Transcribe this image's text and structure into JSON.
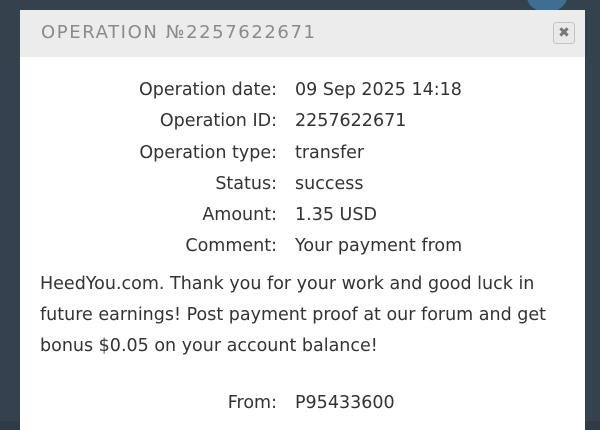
{
  "modal": {
    "title": "OPERATION №2257622671",
    "close_icon": "close-icon",
    "colors": {
      "header_bg": "#ececec",
      "title_text": "#8a8a8a",
      "body_text": "#333333",
      "backdrop": "#34424b"
    }
  },
  "details": {
    "date_label": "Operation date:",
    "date_value": "09 Sep 2025 14:18",
    "id_label": "Operation ID:",
    "id_value": "2257622671",
    "type_label": "Operation type:",
    "type_value": "transfer",
    "status_label": "Status:",
    "status_value": "success",
    "amount_label": "Amount:",
    "amount_value": "1.35 USD",
    "comment_label": "Comment:",
    "comment_first_line": "Your payment from",
    "comment_rest": "HeedYou.com. Thank you for your work and good luck in\nfuture earnings! Post payment proof at our forum and get\nbonus $0.05 on your account balance!",
    "from_label": "From:",
    "from_value": "P95433600"
  }
}
